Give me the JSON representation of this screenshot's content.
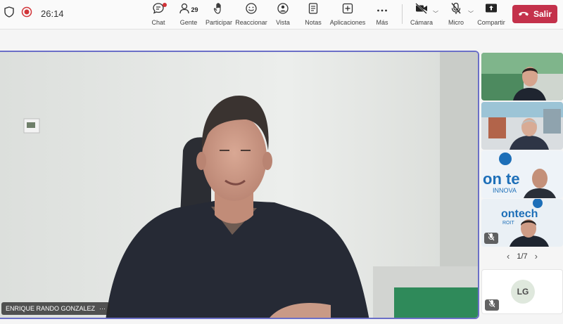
{
  "toolbar": {
    "timer": "26:14",
    "chat_label": "Chat",
    "people_label": "Gente",
    "people_count": "29",
    "participate_label": "Participar",
    "react_label": "Reaccionar",
    "view_label": "Vista",
    "notes_label": "Notas",
    "apps_label": "Aplicaciones",
    "more_label": "Más",
    "camera_label": "Cámara",
    "mic_label": "Micro",
    "share_label": "Compartir",
    "leave_label": "Salir"
  },
  "stage": {
    "speaker_name": "ENRIQUE RANDO GONZALEZ",
    "more_glyph": "···"
  },
  "thumbnails": [
    {
      "muted": false
    },
    {
      "muted": false
    },
    {
      "muted": false,
      "logo_text": "on te",
      "logo_sub": "INNOVA"
    },
    {
      "muted": true,
      "logo_text": "ontech",
      "logo_sub": "ROIT"
    }
  ],
  "pager": {
    "label": "1/7",
    "prev": "‹",
    "next": "›"
  },
  "initials_tile": {
    "initials": "LG",
    "muted": true
  },
  "colors": {
    "leave": "#c4314b",
    "active_border": "#6b6fc7",
    "record": "#d13438"
  }
}
